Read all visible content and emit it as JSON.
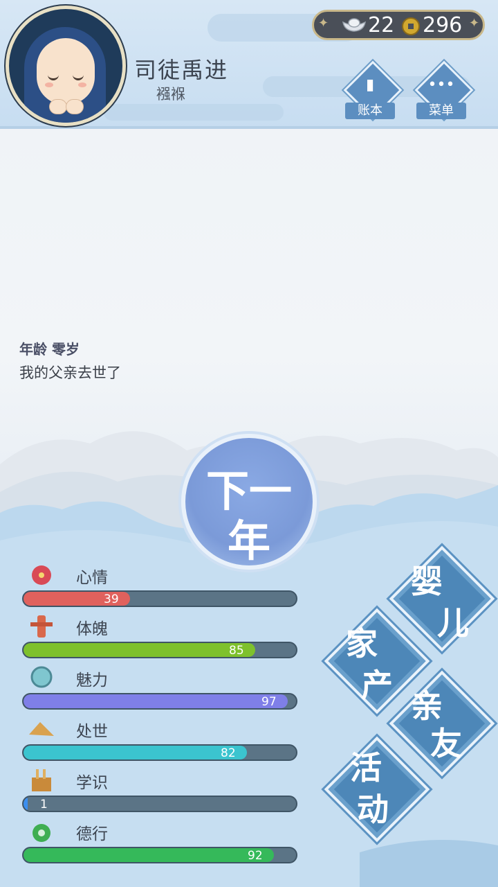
{
  "header": {
    "player_name": "司徒禹进",
    "player_title": "襁褓",
    "currency": {
      "ingot": "22",
      "coin": "296"
    },
    "buttons": [
      {
        "label": "账本",
        "icon": "book-icon"
      },
      {
        "label": "菜单",
        "icon": "more-dots-icon"
      }
    ]
  },
  "log": {
    "age": "年龄 零岁",
    "text": "我的父亲去世了"
  },
  "next_year": {
    "line1": "下一",
    "line2": "年"
  },
  "stats": [
    {
      "name": "心情",
      "value": "39",
      "level": 0.39,
      "color": "#e0615d",
      "icon": "flower-icon"
    },
    {
      "name": "体魄",
      "value": "85",
      "level": 0.85,
      "color": "#7ec12c",
      "icon": "training-post-icon"
    },
    {
      "name": "魅力",
      "value": "97",
      "level": 0.97,
      "color": "#7f7fe8",
      "icon": "mirror-icon"
    },
    {
      "name": "处世",
      "value": "82",
      "level": 0.82,
      "color": "#3bc4cf",
      "icon": "handshake-icon"
    },
    {
      "name": "学识",
      "value": "1",
      "level": 0.01,
      "color": "#3b8ff0",
      "icon": "brush-pot-icon"
    },
    {
      "name": "德行",
      "value": "92",
      "level": 0.92,
      "color": "#35b95a",
      "icon": "jade-pendant-icon"
    }
  ],
  "actions": {
    "infant": {
      "c1": "婴",
      "c2": "儿"
    },
    "property": {
      "c1": "家",
      "c2": "产"
    },
    "relatives": {
      "c1": "亲",
      "c2": "友"
    },
    "activity": {
      "c1": "活",
      "c2": "动"
    }
  }
}
